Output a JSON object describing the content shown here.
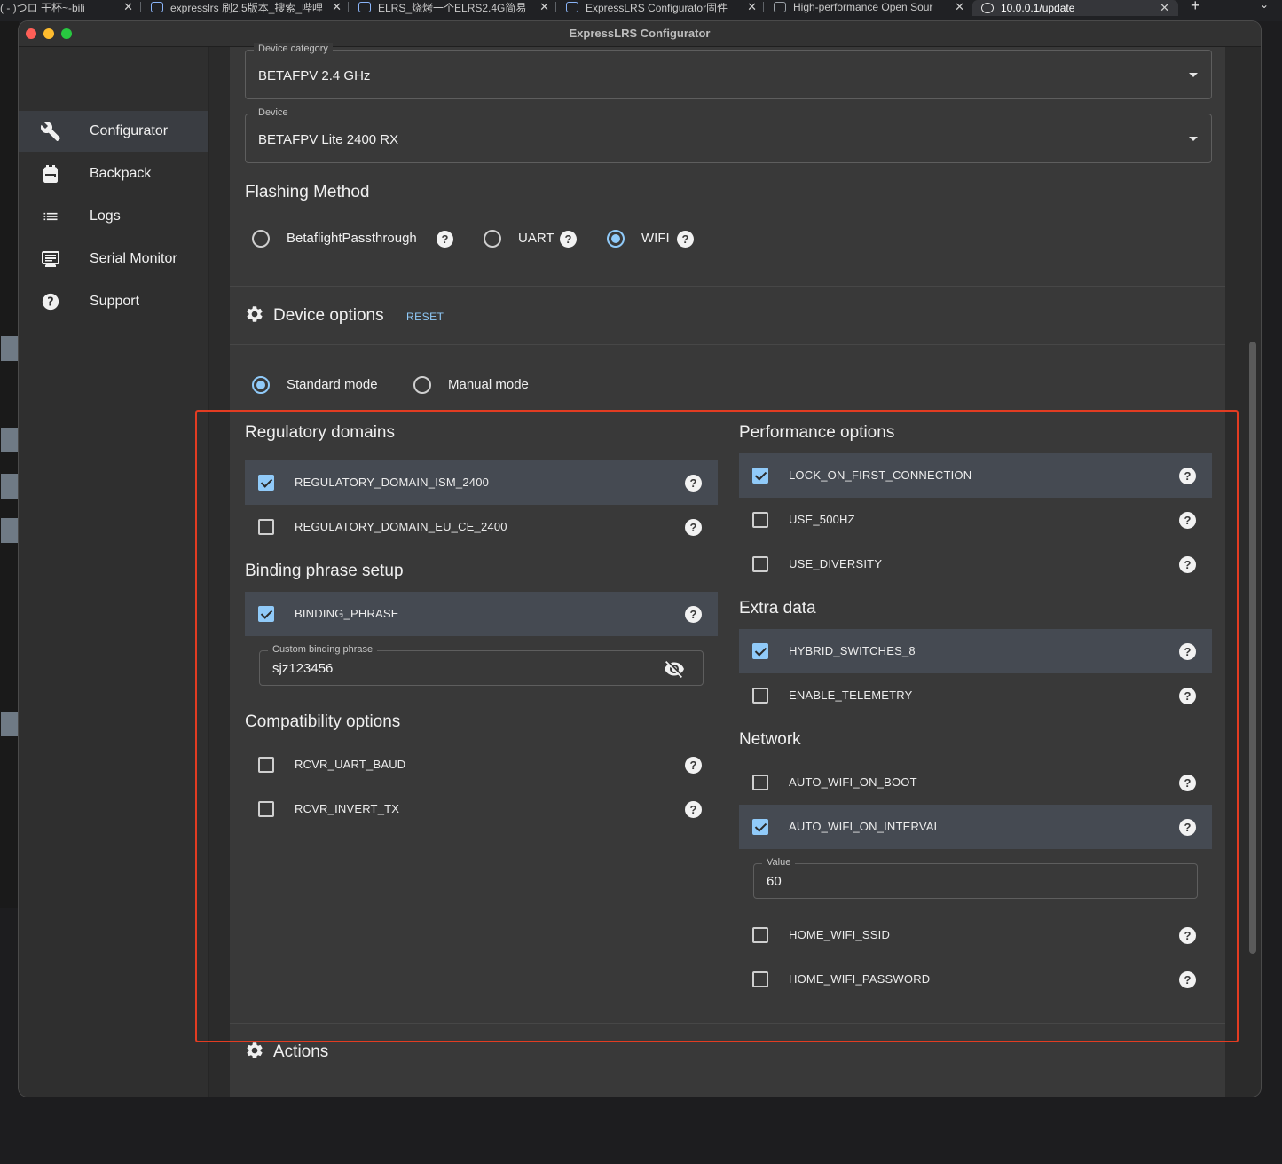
{
  "browser_tabs": [
    {
      "label": "( - )つロ 干杯~-bili",
      "active": false
    },
    {
      "label": "expresslrs 刷2.5版本_搜索_哔哩",
      "active": false
    },
    {
      "label": "ELRS_烧烤一个ELRS2.4G简易",
      "active": false
    },
    {
      "label": "ExpressLRS Configurator固件",
      "active": false
    },
    {
      "label": "High-performance Open Sour",
      "active": false
    },
    {
      "label": "10.0.0.1/update",
      "active": true
    }
  ],
  "window": {
    "title": "ExpressLRS Configurator"
  },
  "sidebar": {
    "items": [
      {
        "label": "Configurator",
        "icon": "wrench-icon",
        "active": true
      },
      {
        "label": "Backpack",
        "icon": "backpack-icon",
        "active": false
      },
      {
        "label": "Logs",
        "icon": "list-icon",
        "active": false
      },
      {
        "label": "Serial Monitor",
        "icon": "monitor-icon",
        "active": false
      },
      {
        "label": "Support",
        "icon": "help-circle-icon",
        "active": false
      }
    ]
  },
  "target": {
    "device_category": {
      "legend": "Device category",
      "value": "BETAFPV 2.4 GHz"
    },
    "device": {
      "legend": "Device",
      "value": "BETAFPV Lite 2400 RX"
    }
  },
  "flashing": {
    "title": "Flashing Method",
    "methods": [
      {
        "label": "BetaflightPassthrough",
        "selected": false
      },
      {
        "label": "UART",
        "selected": false
      },
      {
        "label": "WIFI",
        "selected": true
      }
    ]
  },
  "device_options": {
    "title": "Device options",
    "reset_label": "RESET",
    "modes": [
      {
        "label": "Standard mode",
        "selected": true
      },
      {
        "label": "Manual mode",
        "selected": false
      }
    ],
    "regulatory": {
      "title": "Regulatory domains",
      "options": [
        {
          "label": "REGULATORY_DOMAIN_ISM_2400",
          "checked": true
        },
        {
          "label": "REGULATORY_DOMAIN_EU_CE_2400",
          "checked": false
        }
      ]
    },
    "binding": {
      "title": "Binding phrase setup",
      "options": [
        {
          "label": "BINDING_PHRASE",
          "checked": true
        }
      ],
      "phrase_legend": "Custom binding phrase",
      "phrase_value": "sjz123456"
    },
    "compatibility": {
      "title": "Compatibility options",
      "options": [
        {
          "label": "RCVR_UART_BAUD",
          "checked": false
        },
        {
          "label": "RCVR_INVERT_TX",
          "checked": false
        }
      ]
    },
    "performance": {
      "title": "Performance options",
      "options": [
        {
          "label": "LOCK_ON_FIRST_CONNECTION",
          "checked": true
        },
        {
          "label": "USE_500HZ",
          "checked": false
        },
        {
          "label": "USE_DIVERSITY",
          "checked": false
        }
      ]
    },
    "extra": {
      "title": "Extra data",
      "options": [
        {
          "label": "HYBRID_SWITCHES_8",
          "checked": true
        },
        {
          "label": "ENABLE_TELEMETRY",
          "checked": false
        }
      ]
    },
    "network": {
      "title": "Network",
      "options": [
        {
          "label": "AUTO_WIFI_ON_BOOT",
          "checked": false
        },
        {
          "label": "AUTO_WIFI_ON_INTERVAL",
          "checked": true
        },
        {
          "label": "HOME_WIFI_SSID",
          "checked": false
        },
        {
          "label": "HOME_WIFI_PASSWORD",
          "checked": false
        }
      ],
      "interval_legend": "Value",
      "interval_value": "60"
    }
  },
  "actions": {
    "title": "Actions"
  },
  "colors": {
    "accent": "#90caf9",
    "annotation": "#e23c22",
    "selected_row": "#454a52"
  }
}
